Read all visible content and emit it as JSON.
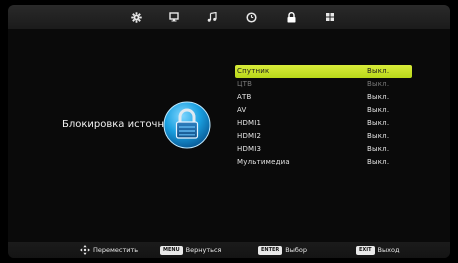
{
  "top_menu": {
    "icons": [
      {
        "name": "settings-gear",
        "selected": false
      },
      {
        "name": "monitor-picture",
        "selected": false
      },
      {
        "name": "music-note-sound",
        "selected": false
      },
      {
        "name": "clock-time",
        "selected": false
      },
      {
        "name": "lock",
        "selected": true
      },
      {
        "name": "grid-apps",
        "selected": false
      }
    ]
  },
  "page": {
    "title": "Блокировка источн..."
  },
  "source_lock": {
    "items": [
      {
        "label": "Спутник",
        "value": "Выкл.",
        "selected": true,
        "dim": false
      },
      {
        "label": "ЦТВ",
        "value": "Выкл.",
        "selected": false,
        "dim": true
      },
      {
        "label": "АТВ",
        "value": "Выкл.",
        "selected": false,
        "dim": false
      },
      {
        "label": "AV",
        "value": "Выкл.",
        "selected": false,
        "dim": false
      },
      {
        "label": "HDMI1",
        "value": "Выкл.",
        "selected": false,
        "dim": false
      },
      {
        "label": "HDMI2",
        "value": "Выкл.",
        "selected": false,
        "dim": false
      },
      {
        "label": "HDMI3",
        "value": "Выкл.",
        "selected": false,
        "dim": false
      },
      {
        "label": "Мультимедиа",
        "value": "Выкл.",
        "selected": false,
        "dim": false
      }
    ]
  },
  "footer": {
    "move_label": "Переместить",
    "menu_key": "MENU",
    "menu_label": "Вернуться",
    "enter_key": "ENTER",
    "enter_label": "Выбор",
    "exit_key": "EXIT",
    "exit_label": "Выход"
  },
  "colors": {
    "highlight": "#c8e22a",
    "accent_blue": "#1aa0e0",
    "background": "#0a0a0a"
  }
}
